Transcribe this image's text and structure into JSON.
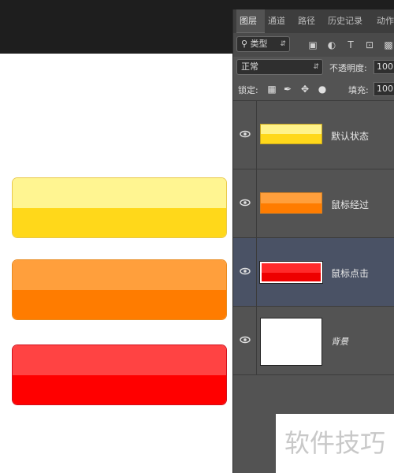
{
  "panel": {
    "tabs": [
      {
        "label": "图层"
      },
      {
        "label": "通道"
      },
      {
        "label": "路径"
      },
      {
        "label": "历史记录"
      },
      {
        "label": "动作"
      }
    ],
    "filter": {
      "kind_label": "类型"
    },
    "blend_mode": "正常",
    "opacity_label": "不透明度:",
    "opacity_value": "100",
    "lock_label": "锁定:",
    "fill_label": "填充:",
    "fill_value": "100",
    "layers": [
      {
        "name": "默认状态"
      },
      {
        "name": "鼠标经过"
      },
      {
        "name": "鼠标点击"
      },
      {
        "name": "背景"
      }
    ]
  },
  "watermark": "软件技巧",
  "colors": {
    "yellow_top": "#fff591",
    "yellow_bottom": "#ffd81a",
    "orange_top": "#ff9f3c",
    "orange_bottom": "#ff7c00",
    "red_top": "#ff4343",
    "red_bottom": "#ff0000",
    "panel_bg": "#535353",
    "selected_layer": "#4a5265"
  }
}
